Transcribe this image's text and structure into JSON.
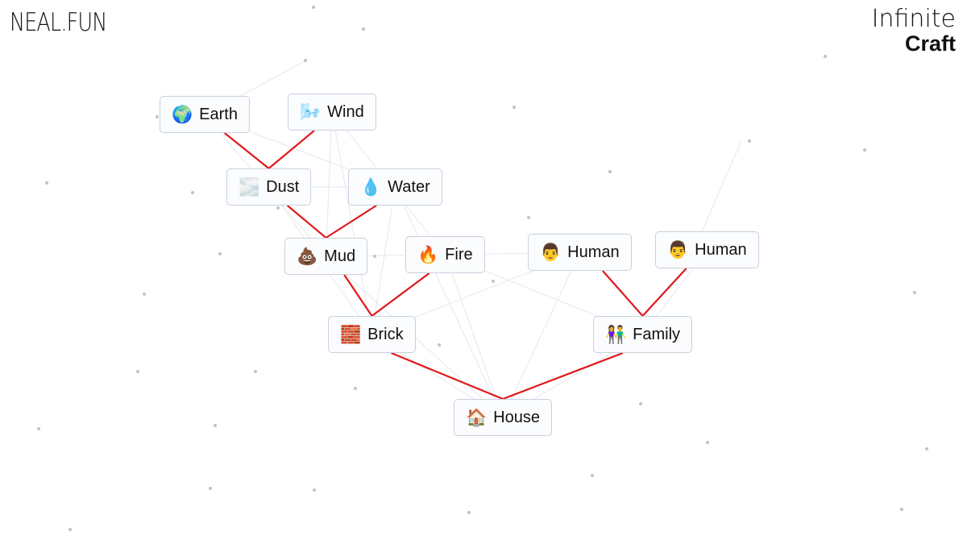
{
  "header": {
    "left_logo": "NEAL.FUN",
    "right_logo_line1": "Infinite",
    "right_logo_line2": "Craft"
  },
  "colors": {
    "recipe_line": "#e0191c",
    "faint_line": "#e6e8ec",
    "dot": "#bfc2c6",
    "node_border": "#c8d0dc",
    "node_bg": "#fbfcfe"
  },
  "nodes": [
    {
      "id": "earth",
      "label": "Earth",
      "emoji": "🌍",
      "icon": "globe-icon"
    },
    {
      "id": "wind",
      "label": "Wind",
      "emoji": "🌬️",
      "icon": "wind-face-icon"
    },
    {
      "id": "dust",
      "label": "Dust",
      "emoji": "🌫️",
      "icon": "waves-icon"
    },
    {
      "id": "water",
      "label": "Water",
      "emoji": "💧",
      "icon": "droplet-icon"
    },
    {
      "id": "mud",
      "label": "Mud",
      "emoji": "💩",
      "icon": "poop-icon"
    },
    {
      "id": "fire",
      "label": "Fire",
      "emoji": "🔥",
      "icon": "fire-icon"
    },
    {
      "id": "human1",
      "label": "Human",
      "emoji": "👨",
      "icon": "man-icon"
    },
    {
      "id": "human2",
      "label": "Human",
      "emoji": "👨",
      "icon": "man-icon"
    },
    {
      "id": "brick",
      "label": "Brick",
      "emoji": "🧱",
      "icon": "brick-icon"
    },
    {
      "id": "family",
      "label": "Family",
      "emoji": "👫",
      "icon": "couple-icon"
    },
    {
      "id": "house",
      "label": "House",
      "emoji": "🏠",
      "icon": "house-icon"
    }
  ],
  "recipes": [
    {
      "inputs": [
        "earth",
        "wind"
      ],
      "output": "dust"
    },
    {
      "inputs": [
        "dust",
        "water"
      ],
      "output": "mud"
    },
    {
      "inputs": [
        "mud",
        "fire"
      ],
      "output": "brick"
    },
    {
      "inputs": [
        "human1",
        "human2"
      ],
      "output": "family"
    },
    {
      "inputs": [
        "brick",
        "family"
      ],
      "output": "house"
    }
  ]
}
